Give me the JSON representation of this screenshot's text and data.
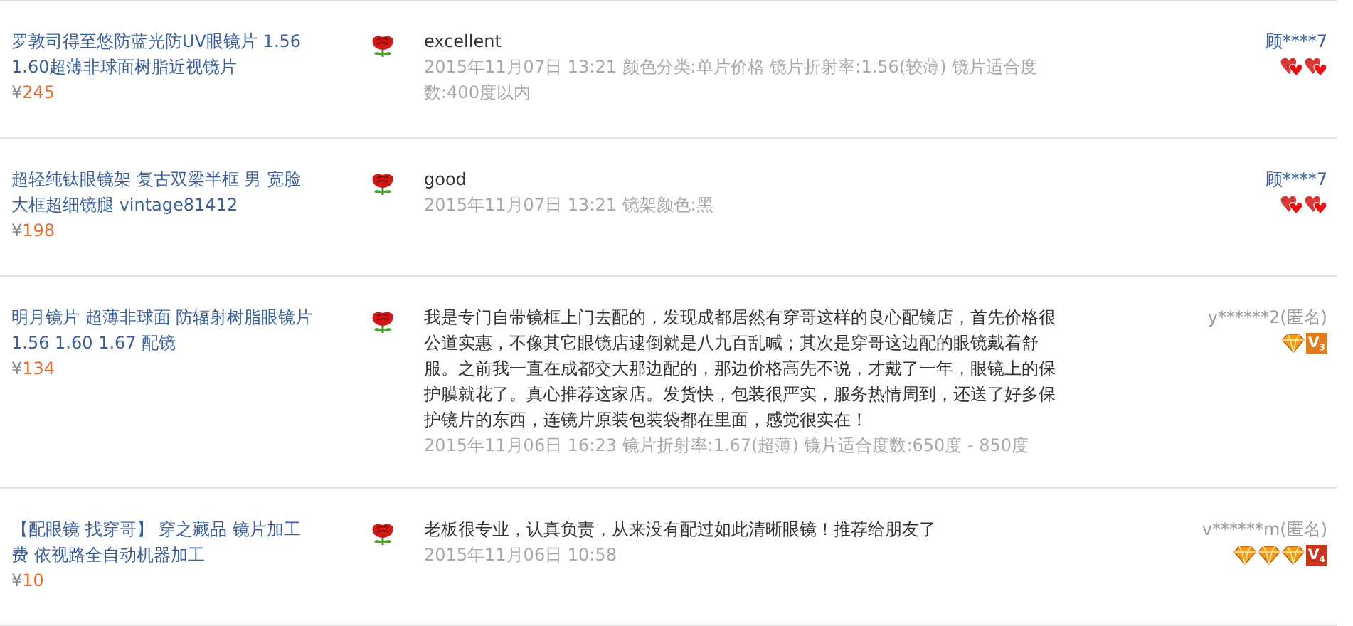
{
  "reviews": [
    {
      "product": {
        "title": "罗敦司得至悠防蓝光防UV眼镜片 1.56 1.60超薄非球面树脂近视镜片",
        "currency": "¥",
        "price": "245"
      },
      "comment": "excellent",
      "meta": "2015年11月07日 13:21 颜色分类:单片价格  镜片折射率:1.56(较薄) 镜片适合度数:400度以内",
      "user": {
        "name": "顾****7",
        "anonymous": false,
        "badges": [
          {
            "kind": "heart"
          },
          {
            "kind": "heart"
          }
        ]
      }
    },
    {
      "product": {
        "title": "超轻纯钛眼镜架 复古双梁半框 男 宽脸大框超细镜腿 vintage81412",
        "currency": "¥",
        "price": "198"
      },
      "comment": "good",
      "meta": "2015年11月07日 13:21 镜架颜色:黑",
      "user": {
        "name": "顾****7",
        "anonymous": false,
        "badges": [
          {
            "kind": "heart"
          },
          {
            "kind": "heart"
          }
        ]
      }
    },
    {
      "product": {
        "title": "明月镜片 超薄非球面 防辐射树脂眼镜片 1.56 1.60 1.67 配镜",
        "currency": "¥",
        "price": "134"
      },
      "comment": "我是专门自带镜框上门去配的，发现成都居然有穿哥这样的良心配镜店，首先价格很公道实惠，不像其它眼镜店逮倒就是八九百乱喊；其次是穿哥这边配的眼镜戴着舒服。之前我一直在成都交大那边配的，那边价格高先不说，才戴了一年，眼镜上的保护膜就花了。真心推荐这家店。发货快，包装很严实，服务热情周到，还送了好多保护镜片的东西，连镜片原装包装袋都在里面，感觉很实在！",
      "meta": "2015年11月06日 16:23 镜片折射率:1.67(超薄) 镜片适合度数:650度 - 850度",
      "user": {
        "name": "y******2(匿名)",
        "anonymous": true,
        "badges": [
          {
            "kind": "diamond"
          },
          {
            "kind": "vip",
            "text": "V$_{3}$"
          }
        ]
      }
    },
    {
      "product": {
        "title": "【配眼镜 找穿哥】 穿之藏品 镜片加工费 依视路全自动机器加工",
        "currency": "¥",
        "price": "10"
      },
      "comment": "老板很专业，认真负责，从来没有配过如此清晰眼镜！推荐给朋友了",
      "meta": "2015年11月06日 10:58",
      "user": {
        "name": "v******m(匿名)",
        "anonymous": true,
        "badges": [
          {
            "kind": "diamond"
          },
          {
            "kind": "diamond"
          },
          {
            "kind": "diamond"
          },
          {
            "kind": "vip",
            "text": "V$_{4}$"
          }
        ]
      }
    }
  ]
}
